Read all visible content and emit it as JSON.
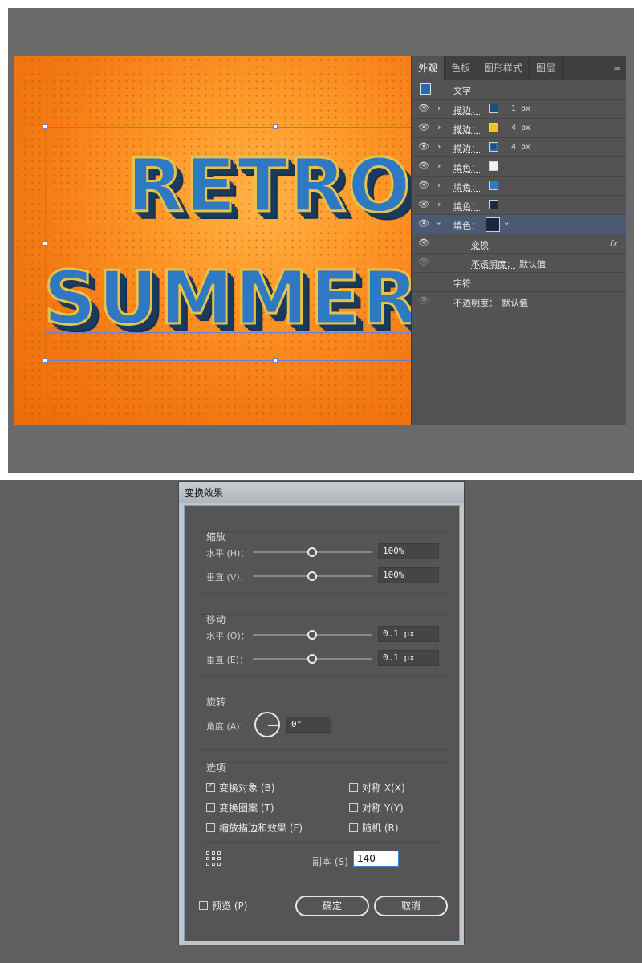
{
  "appearance_panel": {
    "tabs": [
      "外观",
      "色板",
      "图形样式",
      "图层"
    ],
    "menu_icon": "≡",
    "header_label": "文字",
    "rows": [
      {
        "label": "描边：",
        "swatch": "#1f4f7a",
        "value": "1 px",
        "expanded": false
      },
      {
        "label": "描边：",
        "swatch": "#f4c21f",
        "value": "4 px",
        "expanded": false
      },
      {
        "label": "描边：",
        "swatch": "#1f4f7a",
        "value": "4 px",
        "expanded": false
      },
      {
        "label": "填色：",
        "swatch": "#f2f2f2",
        "value": "",
        "expanded": false
      },
      {
        "label": "填色：",
        "swatch": "#2f78c2",
        "value": "",
        "expanded": false
      },
      {
        "label": "填色：",
        "swatch": "#1b2b3c",
        "value": "",
        "expanded": false
      },
      {
        "label": "填色：",
        "swatch": "#17283a",
        "value": "",
        "expanded": true
      }
    ],
    "transform_label": "变换",
    "fx_label": "fx",
    "opacity_label_1": "不透明度：",
    "opacity_value_1": "默认值",
    "chars_label": "字符",
    "opacity_label_2": "不透明度：",
    "opacity_value_2": "默认值"
  },
  "artwork": {
    "line1": "RETRO",
    "line2": "SUMMER"
  },
  "dialog": {
    "title": "变换效果",
    "scale": {
      "title": "缩放",
      "h_label": "水平 (H)：",
      "h_value": "100%",
      "v_label": "垂直 (V)：",
      "v_value": "100%"
    },
    "move": {
      "title": "移动",
      "h_label": "水平 (O)：",
      "h_value": "0.1 px",
      "v_label": "垂直 (E)：",
      "v_value": "0.1 px"
    },
    "rotate": {
      "title": "旋转",
      "angle_label": "角度 (A)：",
      "angle_value": "0°"
    },
    "options": {
      "title": "选项",
      "transform_objects": "变换对象 (B)",
      "transform_patterns": "变换图案 (T)",
      "scale_strokes": "缩放描边和效果 (F)",
      "reflect_x": "对称 X(X)",
      "reflect_y": "对称 Y(Y)",
      "random": "随机 (R)",
      "transform_objects_checked": true,
      "transform_patterns_checked": false,
      "scale_strokes_checked": false,
      "reflect_x_checked": false,
      "reflect_y_checked": false,
      "random_checked": false
    },
    "copies_label": "副本 (S)",
    "copies_value": "140",
    "preview_label": "预览 (P)",
    "ok_label": "确定",
    "cancel_label": "取消"
  }
}
